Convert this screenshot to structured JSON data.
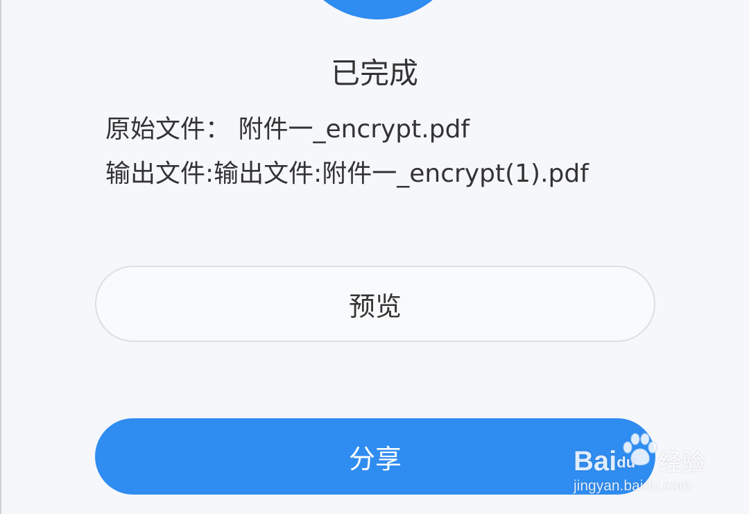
{
  "result": {
    "title": "已完成",
    "original_file": "原始文件：  附件一_encrypt.pdf",
    "output_file": "输出文件:输出文件:附件一_encrypt(1).pdf"
  },
  "actions": {
    "preview_label": "预览",
    "share_label": "分享"
  },
  "watermark": {
    "brand_bai": "Bai",
    "brand_du": "du",
    "brand_jingyan": "经验",
    "url": "jingyan.baidu.com"
  },
  "colors": {
    "accent": "#2f8cf0",
    "background": "#f5f7fa",
    "text": "#333333"
  },
  "icons": {
    "status": "status-circle-icon",
    "watermark": "baidu-paw-icon"
  }
}
